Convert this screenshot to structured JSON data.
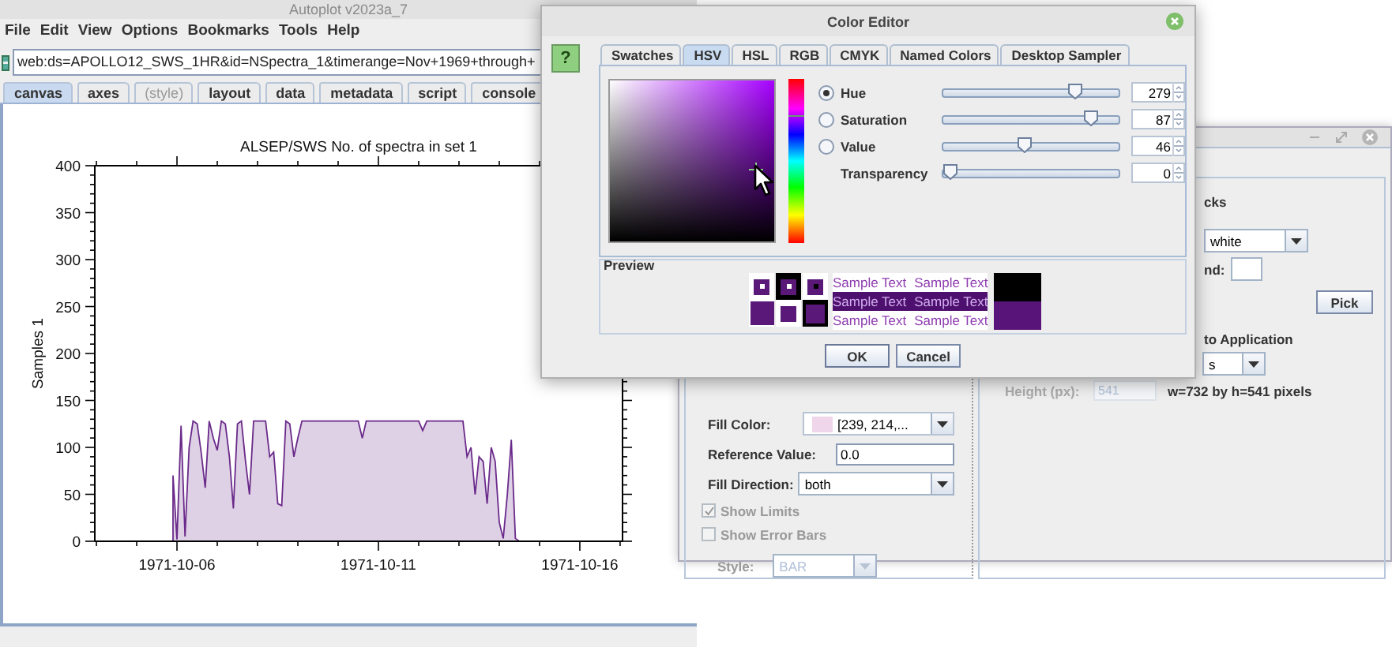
{
  "main_window": {
    "title": "Autoplot v2023a_7",
    "menu": [
      "File",
      "Edit",
      "View",
      "Options",
      "Bookmarks",
      "Tools",
      "Help"
    ],
    "url": {
      "value": "web:ds=APOLLO12_SWS_1HR&id=NSpectra_1&timerange=Nov+1969+through+"
    },
    "tabs": [
      {
        "label": "canvas",
        "selected": true,
        "disabled": false
      },
      {
        "label": "axes",
        "selected": false,
        "disabled": false
      },
      {
        "label": "(style)",
        "selected": false,
        "disabled": true
      },
      {
        "label": "layout",
        "selected": false,
        "disabled": false
      },
      {
        "label": "data",
        "selected": false,
        "disabled": false
      },
      {
        "label": "metadata",
        "selected": false,
        "disabled": false
      },
      {
        "label": "script",
        "selected": false,
        "disabled": false
      },
      {
        "label": "console",
        "selected": false,
        "disabled": false
      }
    ],
    "chart_data": {
      "type": "area",
      "title": "ALSEP/SWS  No. of spectra in set 1",
      "ylabel": "Samples 1",
      "categories": [
        null,
        null,
        null,
        null,
        null,
        null,
        null,
        null,
        null,
        null,
        null,
        null,
        null,
        null,
        null,
        null,
        null,
        null,
        null,
        null,
        "1971-10-06",
        null,
        null,
        null,
        null,
        null,
        null,
        null,
        null,
        null,
        null,
        null,
        null,
        null,
        null,
        null,
        null,
        null,
        null,
        null,
        null,
        null,
        null,
        null,
        null,
        null,
        null,
        null,
        null,
        null,
        null,
        null,
        null,
        null,
        null,
        null,
        null,
        null,
        null,
        null,
        null,
        null,
        null,
        null,
        null,
        null,
        null,
        null,
        null,
        null,
        "1971-10-11",
        null,
        null,
        null,
        null,
        null,
        null,
        null,
        null,
        null,
        null,
        null,
        null,
        null,
        null,
        null,
        null,
        null,
        null,
        null,
        null,
        null,
        null,
        null,
        null,
        null,
        null,
        null,
        null,
        null,
        null,
        null,
        null,
        null,
        null,
        null,
        null,
        null,
        null,
        null,
        null,
        null,
        null,
        null,
        null,
        null,
        null,
        null,
        null,
        null,
        "1971-10-16",
        null,
        null,
        null,
        null,
        null,
        null,
        null,
        null,
        null,
        null
      ],
      "series": [
        {
          "color": "#6a2a8a",
          "values": [
            null,
            null,
            null,
            null,
            null,
            null,
            null,
            null,
            null,
            null,
            null,
            null,
            null,
            null,
            null,
            null,
            null,
            null,
            null,
            70,
            2,
            123,
            5,
            100,
            128,
            125,
            95,
            57,
            128,
            110,
            97,
            128,
            125,
            90,
            35,
            125,
            128,
            85,
            50,
            128,
            128,
            128,
            128,
            90,
            95,
            40,
            38,
            128,
            125,
            90,
            110,
            128,
            128,
            128,
            128,
            128,
            128,
            128,
            128,
            128,
            128,
            128,
            128,
            128,
            128,
            128,
            110,
            128,
            128,
            128,
            128,
            128,
            128,
            128,
            128,
            128,
            128,
            128,
            128,
            128,
            128,
            118,
            128,
            128,
            128,
            128,
            128,
            128,
            128,
            128,
            128,
            128,
            90,
            100,
            50,
            90,
            85,
            40,
            100,
            85,
            20,
            3,
            50,
            108,
            3,
            0,
            null,
            null,
            null,
            null,
            null,
            null,
            null,
            null,
            null,
            null,
            null,
            null,
            null,
            null,
            null,
            null,
            null,
            null,
            null,
            null,
            null,
            null,
            null,
            null,
            null
          ]
        }
      ],
      "ylim": [
        0,
        400
      ],
      "yticks": [
        0,
        50,
        100,
        150,
        200,
        250,
        300,
        350,
        400
      ]
    }
  },
  "properties_window": {
    "rows": [
      {
        "kind": "color-combo",
        "label": "Fill Color:",
        "value": "[239, 214,...",
        "disabled": false
      },
      {
        "kind": "field",
        "label": "Reference Value:",
        "value": "0.0",
        "disabled": false
      },
      {
        "kind": "combo",
        "label": "Fill Direction:",
        "value": "both",
        "disabled": false
      },
      {
        "kind": "checkbox",
        "label": "Show Limits",
        "checked": true,
        "disabled": true
      },
      {
        "kind": "checkbox",
        "label": "Show Error Bars",
        "checked": false,
        "disabled": true
      },
      {
        "kind": "combo",
        "label": "Style:",
        "value": "BAR",
        "disabled": true
      }
    ],
    "right": {
      "heading_fragment": "cks",
      "combo_1": {
        "value": "white"
      },
      "label_fragment": "nd:",
      "pick_button": "Pick",
      "section_fragment": "to Application",
      "combo_2": {
        "value": "s"
      },
      "height": {
        "label": "Height (px):",
        "value": "541",
        "disabled": true
      },
      "size_text": "w=732 by h=541 pixels"
    }
  },
  "color_editor": {
    "title": "Color Editor",
    "help_button": "?",
    "tabs": [
      {
        "label": "Swatches",
        "selected": false
      },
      {
        "label": "HSV",
        "selected": true
      },
      {
        "label": "HSL",
        "selected": false
      },
      {
        "label": "RGB",
        "selected": false
      },
      {
        "label": "CMYK",
        "selected": false
      },
      {
        "label": "Named Colors",
        "selected": false
      },
      {
        "label": "Desktop Sampler",
        "selected": false
      }
    ],
    "controls": [
      {
        "kind": "radio",
        "label": "Hue",
        "selected": true,
        "level": 0.775,
        "value": "279"
      },
      {
        "kind": "radio",
        "label": "Saturation",
        "selected": false,
        "level": 0.87,
        "value": "87"
      },
      {
        "kind": "radio",
        "label": "Value",
        "selected": false,
        "level": 0.46,
        "value": "46"
      },
      {
        "kind": "plain",
        "label": "Transparency",
        "level": 0,
        "value": "0"
      }
    ],
    "preview": {
      "label": "Preview",
      "sample_rows": [
        {
          "kind": "plain",
          "texts": [
            "Sample Text",
            "Sample Text"
          ]
        },
        {
          "kind": "inverse",
          "texts": [
            "Sample Text",
            "Sample Text"
          ]
        },
        {
          "kind": "plain",
          "texts": [
            "Sample Text",
            "Sample Text"
          ]
        }
      ]
    },
    "buttons": [
      "OK",
      "Cancel"
    ]
  }
}
